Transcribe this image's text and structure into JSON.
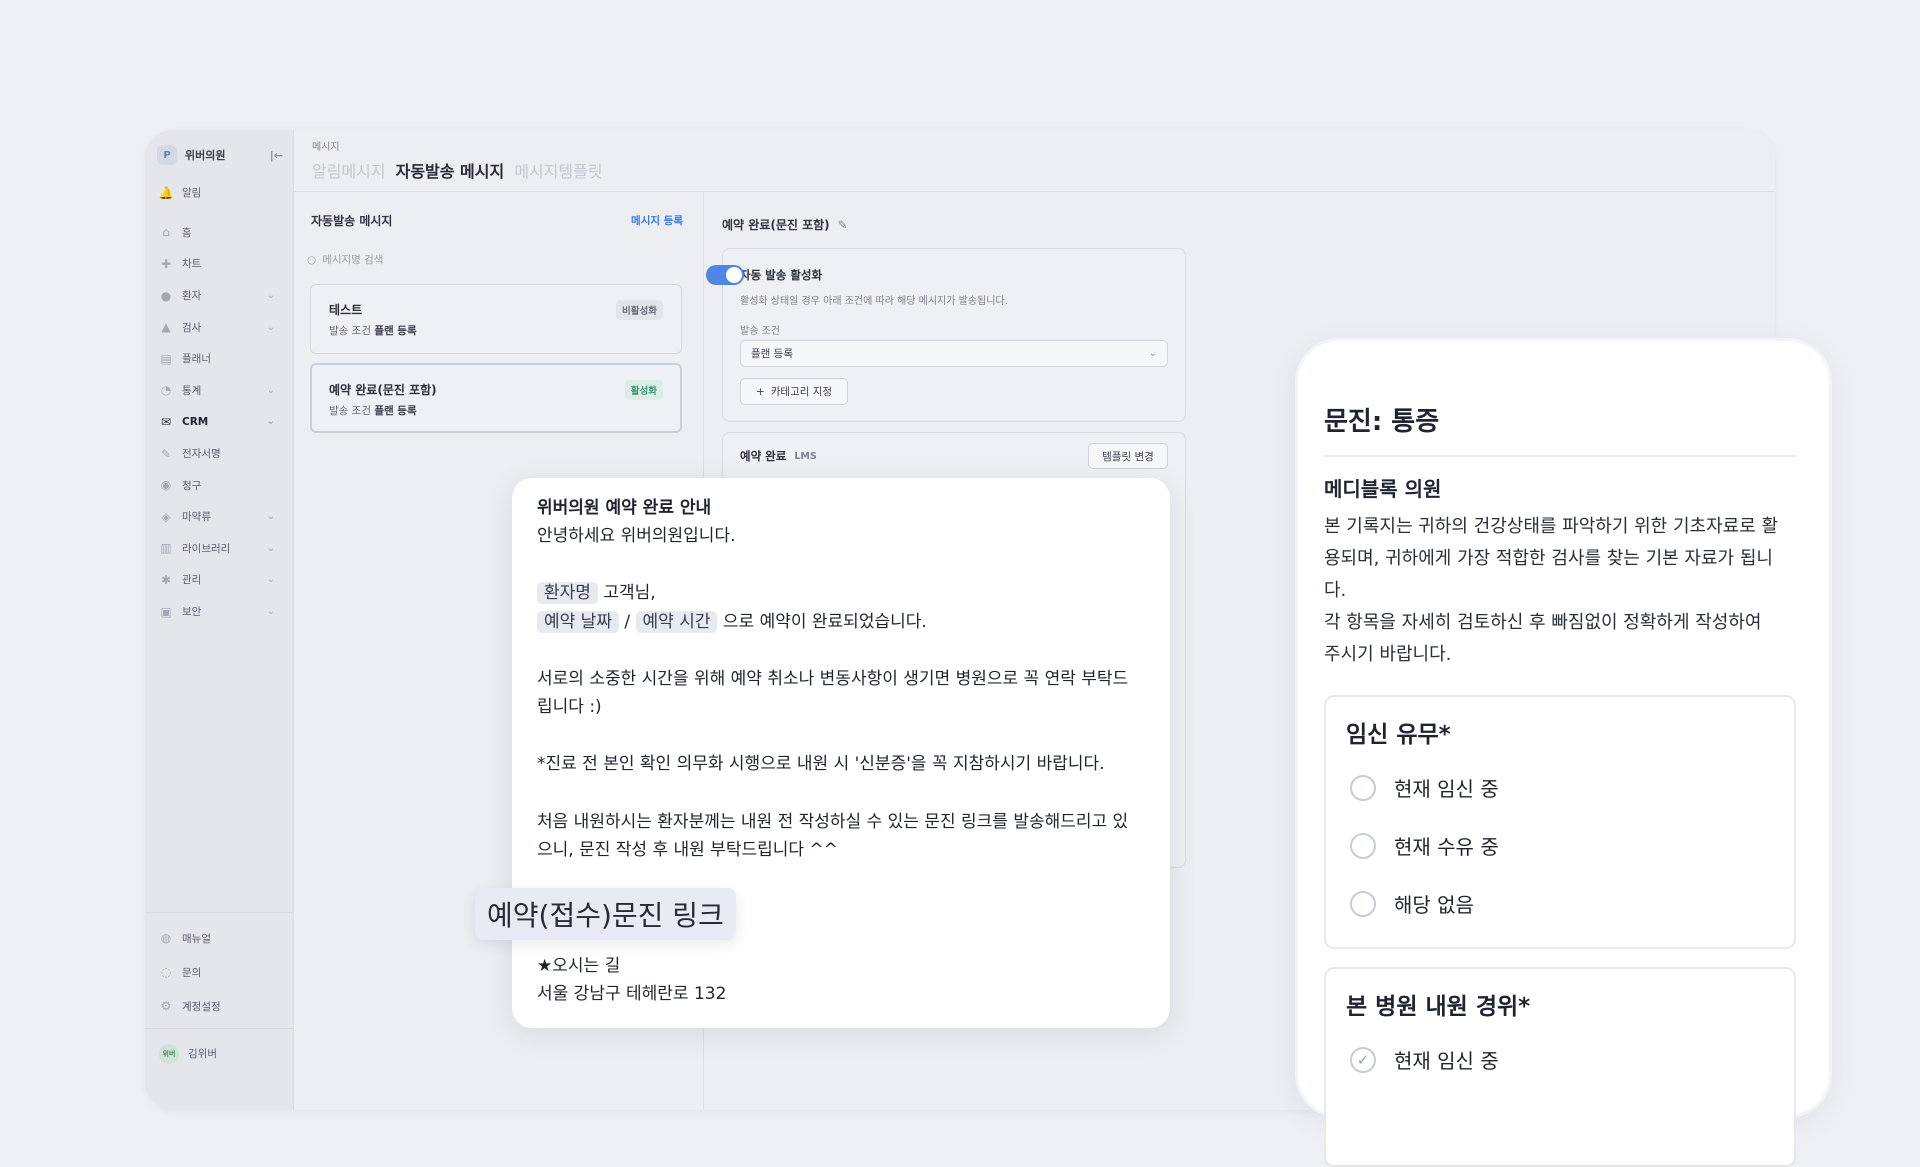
{
  "sidebar": {
    "brand_letter": "P",
    "brand_name": "위버의원",
    "collapse_icon": "|←",
    "items": [
      {
        "label": "알림",
        "icon": "bell-icon",
        "glyph": "🔔",
        "chevron": false
      },
      {
        "label": "홈",
        "icon": "home-icon",
        "glyph": "⌂",
        "chevron": false
      },
      {
        "label": "차트",
        "icon": "plus-icon",
        "glyph": "✚",
        "chevron": false
      },
      {
        "label": "환자",
        "icon": "user-icon",
        "glyph": "●",
        "chevron": true
      },
      {
        "label": "검사",
        "icon": "flask-icon",
        "glyph": "▲",
        "chevron": true
      },
      {
        "label": "플래너",
        "icon": "calendar-icon",
        "glyph": "▤",
        "chevron": false
      },
      {
        "label": "통계",
        "icon": "pie-chart-icon",
        "glyph": "◔",
        "chevron": true
      },
      {
        "label": "CRM",
        "icon": "mail-icon",
        "glyph": "✉",
        "chevron": true,
        "active": true
      },
      {
        "label": "전자서명",
        "icon": "signature-icon",
        "glyph": "✎",
        "chevron": false
      },
      {
        "label": "청구",
        "icon": "check-circle-icon",
        "glyph": "◉",
        "chevron": false
      },
      {
        "label": "마약류",
        "icon": "pill-icon",
        "glyph": "◈",
        "chevron": true
      },
      {
        "label": "라이브러리",
        "icon": "library-icon",
        "glyph": "▥",
        "chevron": true
      },
      {
        "label": "관리",
        "icon": "wrench-icon",
        "glyph": "✱",
        "chevron": true
      },
      {
        "label": "보안",
        "icon": "lock-icon",
        "glyph": "▣",
        "chevron": true
      }
    ],
    "bottom_items": [
      {
        "label": "매뉴얼",
        "icon": "manual-icon",
        "glyph": "◍"
      },
      {
        "label": "문의",
        "icon": "chat-icon",
        "glyph": "◌"
      },
      {
        "label": "계정설정",
        "icon": "gear-icon",
        "glyph": "⚙"
      }
    ],
    "user_avatar": "위버",
    "user_name": "김위버"
  },
  "header": {
    "section": "메시지",
    "tabs": [
      {
        "label": "알림메시지",
        "active": false
      },
      {
        "label": "자동발송 메시지",
        "active": true
      },
      {
        "label": "메시지템플릿",
        "active": false
      }
    ]
  },
  "list": {
    "title": "자동발송 메시지",
    "register_label": "메시지 등록",
    "search_placeholder": "메시지명 검색",
    "items": [
      {
        "title": "테스트",
        "sub_prefix": "발송 조건",
        "sub_value": "플랜 등록",
        "badge": "비활성화"
      },
      {
        "title": "예약 완료(문진 포함)",
        "sub_prefix": "발송 조건",
        "sub_value": "플랜 등록",
        "badge": "활성화"
      }
    ]
  },
  "detail": {
    "title": "예약 완료(문진 포함)",
    "auto_send_label": "자동 발송 활성화",
    "auto_send_enabled": true,
    "auto_send_desc": "활성화 상태일 경우 아래 조건에 따라 해당 메시지가 발송됩니다.",
    "condition_label": "발송 조건",
    "condition_value": "플랜 등록",
    "category_button": "카테고리 지정",
    "template_name": "예약 완료",
    "template_type": "LMS",
    "template_change_button": "템플릿 변경"
  },
  "message": {
    "title": "위버의원 예약 완료 안내",
    "greeting": "안녕하세요 위버의원입니다.",
    "var_patient": "환자명",
    "after_patient": "고객님,",
    "var_date": "예약 날짜",
    "slash": "/",
    "var_time": "예약 시간",
    "after_time": "으로 예약이 완료되었습니다.",
    "para1_line1": "서로의 소중한 시간을 위해 예약 취소나 변동사항이 생기면 병원으로 꼭 연락 부탁드",
    "para1_line2": "립니다 :)",
    "para2": "*진료 전 본인 확인 의무화 시행으로 내원 시 '신분증'을 꼭 지참하시기 바랍니다.",
    "para3_line1": "처음 내원하시는 환자분께는 내원 전 작성하실 수 있는 문진 링크를 발송해드리고 있",
    "para3_line2": "으니, 문진 작성 후 내원 부탁드립니다 ^^",
    "link_chip": "예약(접수)문진 링크",
    "directions_title": "★오시는 길",
    "address": "서울 강남구 테헤란로 132"
  },
  "questionnaire": {
    "title": "문진: 통증",
    "clinic": "메디블록 의원",
    "desc_lines": [
      "본 기록지는 귀하의 건강상태를 파악하기 위한 기초자료로 활",
      "용되며, 귀하에게 가장 적합한 검사를 찾는 기본 자료가 됩니",
      "다.",
      "각 항목을 자세히 검토하신 후 빠짐없이 정확하게 작성하여",
      "주시기 바랍니다."
    ],
    "q1": {
      "heading": "임신 유무*",
      "options": [
        "현재 임신 중",
        "현재 수유 중",
        "해당 없음"
      ]
    },
    "q2": {
      "heading": "본 병원 내원 경위*",
      "options": [
        "현재 임신 중"
      ]
    }
  }
}
